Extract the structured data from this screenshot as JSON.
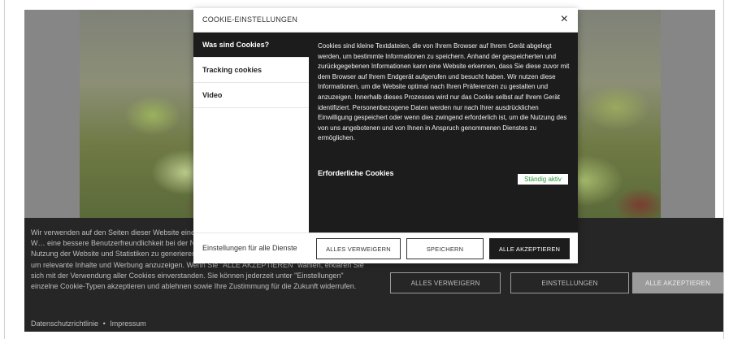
{
  "banner": {
    "text": "Wir verwenden auf den Seiten dieser Website eine… Unverzichtbare Cookies, die für die Nutzung der W… eine bessere Benutzerfreundlichkeit bei der Nutzu… verwenden, um aggregierte Daten über die Nutzung der Website und Statistiken zu generieren, und Marketing-Cookies, die verwendet werden, um relevante Inhalte und Werbung anzuzeigen. Wenn Sie \"ALLE AKZEPTIEREN\" wählen, erklären Sie sich mit der Verwendung aller Cookies einverstanden. Sie können jederzeit unter \"Einstellungen\" einzelne Cookie-Typen akzeptieren und ablehnen sowie Ihre Zustimmung für die Zukunft widerrufen.",
    "privacy_link": "Datenschutzrichtlinie",
    "separator": "•",
    "imprint_link": "Impressum",
    "reject_label": "ALLES VERWEIGERN",
    "settings_label": "EINSTELLUNGEN",
    "accept_label": "ALLE AKZEPTIEREN"
  },
  "modal": {
    "title": "COOKIE-EINSTELLUNGEN",
    "close_icon": "×",
    "tabs": [
      {
        "label": "Was sind Cookies?",
        "active": true
      },
      {
        "label": "Tracking cookies",
        "active": false
      },
      {
        "label": "Video",
        "active": false
      }
    ],
    "body_text": "Cookies sind kleine Textdateien, die von Ihrem Browser auf Ihrem Gerät abgelegt werden, um bestimmte Informationen zu speichern. Anhand der gespeicherten und zurückgegebenen Informationen kann eine Website erkennen, dass Sie diese zuvor mit dem Browser auf Ihrem Endgerät aufgerufen und besucht haben. Wir nutzen diese Informationen, um die Website optimal nach Ihren Präferenzen zu gestalten und anzuzeigen. Innerhalb dieses Prozesses wird nur das Cookie selbst auf Ihrem Gerät identifiziert. Personenbezogene Daten werden nur nach Ihrer ausdrücklichen Einwilligung gespeichert oder wenn dies zwingend erforderlich ist, um die Nutzung des von uns angebotenen und von Ihnen in Anspruch genommenen Dienstes zu ermöglichen.",
    "required_title": "Erforderliche Cookies",
    "always_active": "Ständig aktiv",
    "footer_label": "Einstellungen für alle Dienste",
    "reject_label": "ALLES VERWEIGERN",
    "save_label": "SPEICHERN",
    "accept_label": "ALLE AKZEPTIEREN"
  },
  "colors": {
    "dark": "#1c1c1c",
    "badge_green": "#2e9b3a"
  }
}
